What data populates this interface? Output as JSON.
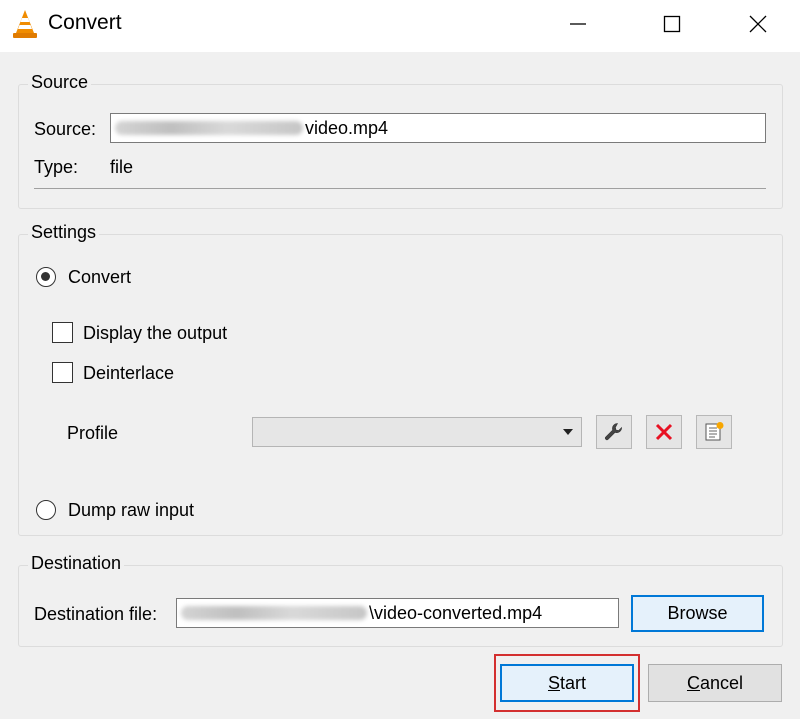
{
  "window": {
    "title": "Convert"
  },
  "source": {
    "legend": "Source",
    "source_label": "Source:",
    "source_value": "video.mp4",
    "type_label": "Type:",
    "type_value": "file"
  },
  "settings": {
    "legend": "Settings",
    "convert_label": "Convert",
    "convert_selected": true,
    "display_output_label": "Display the output",
    "deinterlace_label": "Deinterlace",
    "profile_label": "Profile",
    "profile_value": "",
    "dump_raw_label": "Dump raw input"
  },
  "destination": {
    "legend": "Destination",
    "file_label": "Destination file:",
    "file_value": "\\video-converted.mp4",
    "browse_label": "Browse"
  },
  "actions": {
    "start_first": "S",
    "start_rest": "tart",
    "cancel_first": "C",
    "cancel_rest": "ancel"
  },
  "colors": {
    "focus_border": "#0078d7",
    "highlight": "#d32f2f",
    "delete_icon": "#e81123"
  }
}
